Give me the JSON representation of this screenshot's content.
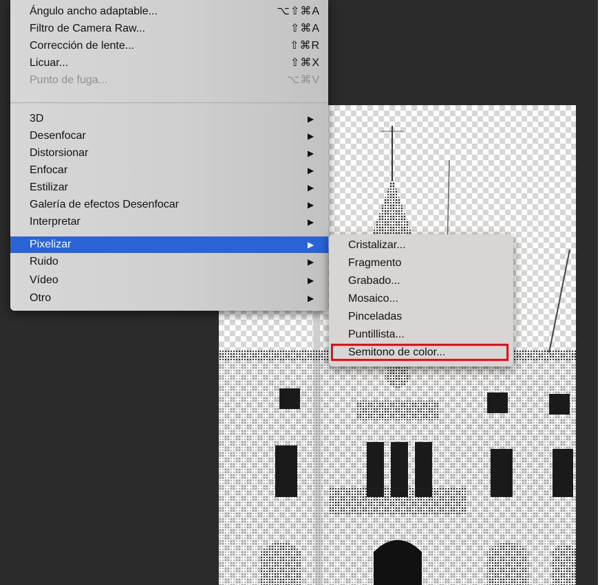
{
  "menu": {
    "top_items": [
      {
        "label": "Ángulo ancho adaptable...",
        "shortcut": "⌥⇧⌘A",
        "disabled": false
      },
      {
        "label": "Filtro de Camera Raw...",
        "shortcut": "⇧⌘A",
        "disabled": false
      },
      {
        "label": "Corrección de lente...",
        "shortcut": "⇧⌘R",
        "disabled": false
      },
      {
        "label": "Licuar...",
        "shortcut": "⇧⌘X",
        "disabled": false
      },
      {
        "label": "Punto de fuga...",
        "shortcut": "⌥⌘V",
        "disabled": true
      }
    ],
    "submenu_items": [
      {
        "label": "3D"
      },
      {
        "label": "Desenfocar"
      },
      {
        "label": "Distorsionar"
      },
      {
        "label": "Enfocar"
      },
      {
        "label": "Estilizar"
      },
      {
        "label": "Galería de efectos Desenfocar"
      },
      {
        "label": "Interpretar"
      },
      {
        "label": "Pixelizar",
        "active": true
      },
      {
        "label": "Ruido"
      },
      {
        "label": "Vídeo"
      },
      {
        "label": "Otro"
      }
    ],
    "arrow_glyph": "▶"
  },
  "pixelizar_submenu": {
    "items": [
      "Cristalizar...",
      "Fragmento",
      "Grabado...",
      "Mosaico...",
      "Pinceladas",
      "Puntillista...",
      "Semitono de color..."
    ],
    "highlighted": "Semitono de color..."
  },
  "colors": {
    "active_item": "#2a63d4",
    "highlight_box": "#d0171f",
    "app_background": "#2b2b2b"
  }
}
